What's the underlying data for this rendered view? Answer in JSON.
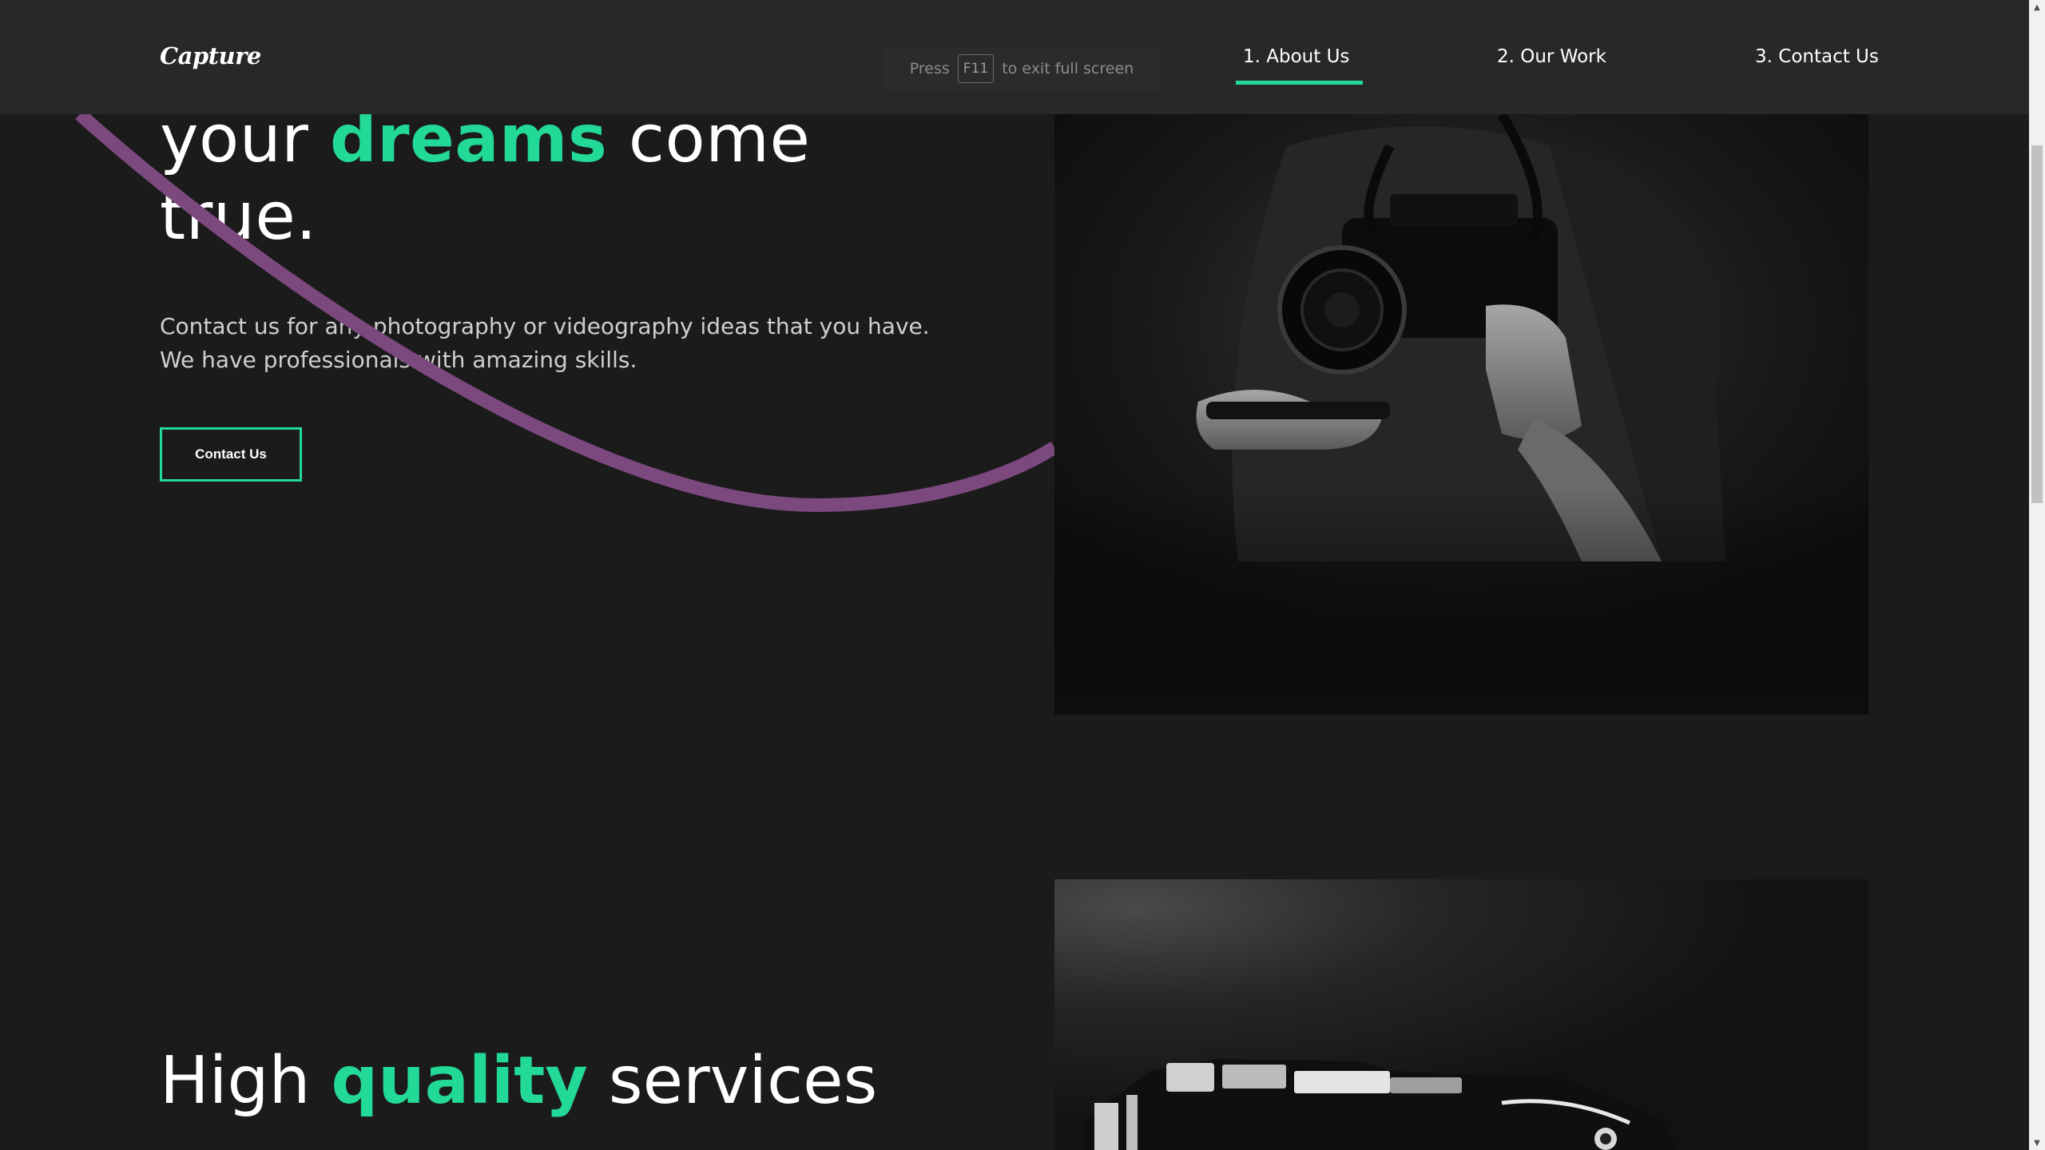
{
  "nav": {
    "logo": "Capture",
    "fullscreen_hint": {
      "prefix": "Press",
      "key": "F11",
      "suffix": "to exit full screen"
    },
    "links": [
      {
        "label": "1. About Us",
        "active": true
      },
      {
        "label": "2. Our Work",
        "active": false
      },
      {
        "label": "3. Contact Us",
        "active": false
      }
    ]
  },
  "hero": {
    "title_line1_start": "your ",
    "title_line1_accent": "dreams",
    "title_line1_end": " come",
    "title_line2": "true.",
    "description": "Contact us for any photography or videography ideas that you have. We have professionals with amazing skills.",
    "button_label": "Contact Us"
  },
  "services": {
    "title_start": "High ",
    "title_accent": "quality",
    "title_end": " services"
  },
  "colors": {
    "background": "#1b1b1b",
    "navbar": "#282828",
    "accent_green": "#23d997",
    "curve_purple": "#7c497f"
  },
  "icons": {
    "scroll_up": "scroll-up-arrow-icon",
    "scroll_down": "scroll-down-arrow-icon"
  }
}
